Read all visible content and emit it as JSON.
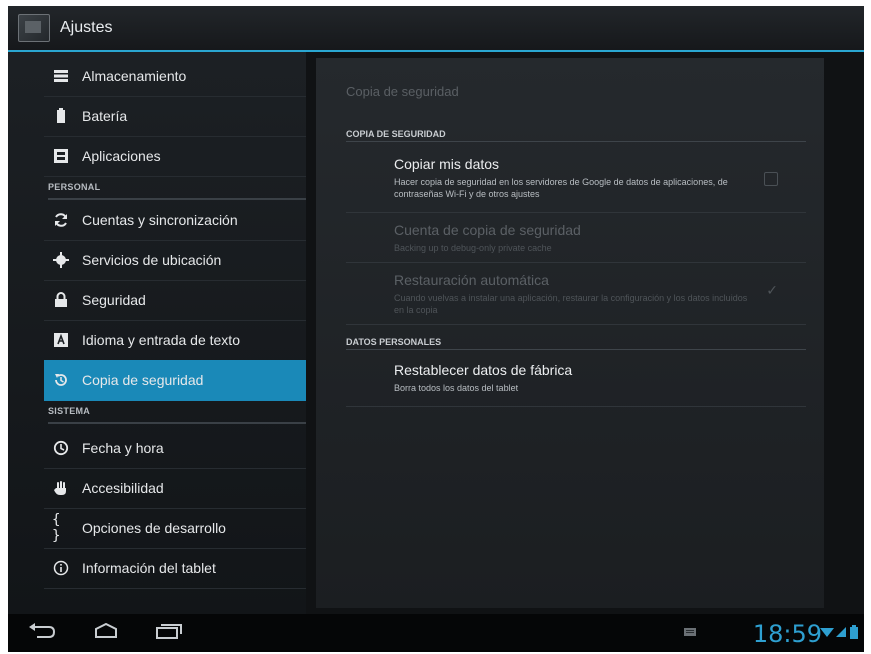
{
  "actionbar": {
    "title": "Ajustes",
    "icon": "settings-app-icon"
  },
  "sidebar": {
    "items": [
      {
        "label": "Almacenamiento",
        "icon": "storage-icon"
      },
      {
        "label": "Batería",
        "icon": "battery-icon"
      },
      {
        "label": "Aplicaciones",
        "icon": "apps-icon"
      }
    ],
    "section_personal": "PERSONAL",
    "personal_items": [
      {
        "label": "Cuentas y sincronización",
        "icon": "sync-icon"
      },
      {
        "label": "Servicios de ubicación",
        "icon": "location-icon"
      },
      {
        "label": "Seguridad",
        "icon": "lock-icon"
      },
      {
        "label": "Idioma y entrada de texto",
        "icon": "language-icon"
      },
      {
        "label": "Copia de seguridad",
        "icon": "backup-icon",
        "selected": true
      }
    ],
    "section_sistema": "SISTEMA",
    "system_items": [
      {
        "label": "Fecha y hora",
        "icon": "clock-icon"
      },
      {
        "label": "Accesibilidad",
        "icon": "hand-icon"
      },
      {
        "label": "Opciones de desarrollo",
        "icon": "braces-icon"
      },
      {
        "label": "Información del tablet",
        "icon": "info-icon"
      }
    ]
  },
  "content": {
    "title": "Copia de seguridad",
    "section_backup": "COPIA DE SEGURIDAD",
    "copy_data": {
      "title": "Copiar mis datos",
      "summary": "Hacer copia de seguridad en los servidores de Google de datos de aplicaciones, de contraseñas Wi-Fi y de otros ajustes",
      "checked": false
    },
    "backup_account": {
      "title": "Cuenta de copia de seguridad",
      "summary": "Backing up to debug-only private cache",
      "enabled": false
    },
    "auto_restore": {
      "title": "Restauración automática",
      "summary": "Cuando vuelvas a instalar una aplicación, restaurar la configuración y los datos incluidos en la copia",
      "checked": true,
      "enabled": false
    },
    "section_personal_data": "DATOS PERSONALES",
    "factory_reset": {
      "title": "Restablecer datos de fábrica",
      "summary": "Borra todos los datos del tablet"
    }
  },
  "navbar": {
    "time": "18:59",
    "back_icon": "back-icon",
    "home_icon": "home-icon",
    "recents_icon": "recents-icon"
  },
  "colors": {
    "accent": "#1a89b8",
    "clock": "#2e9fd0",
    "actionbar_line": "#2aa6d1"
  }
}
